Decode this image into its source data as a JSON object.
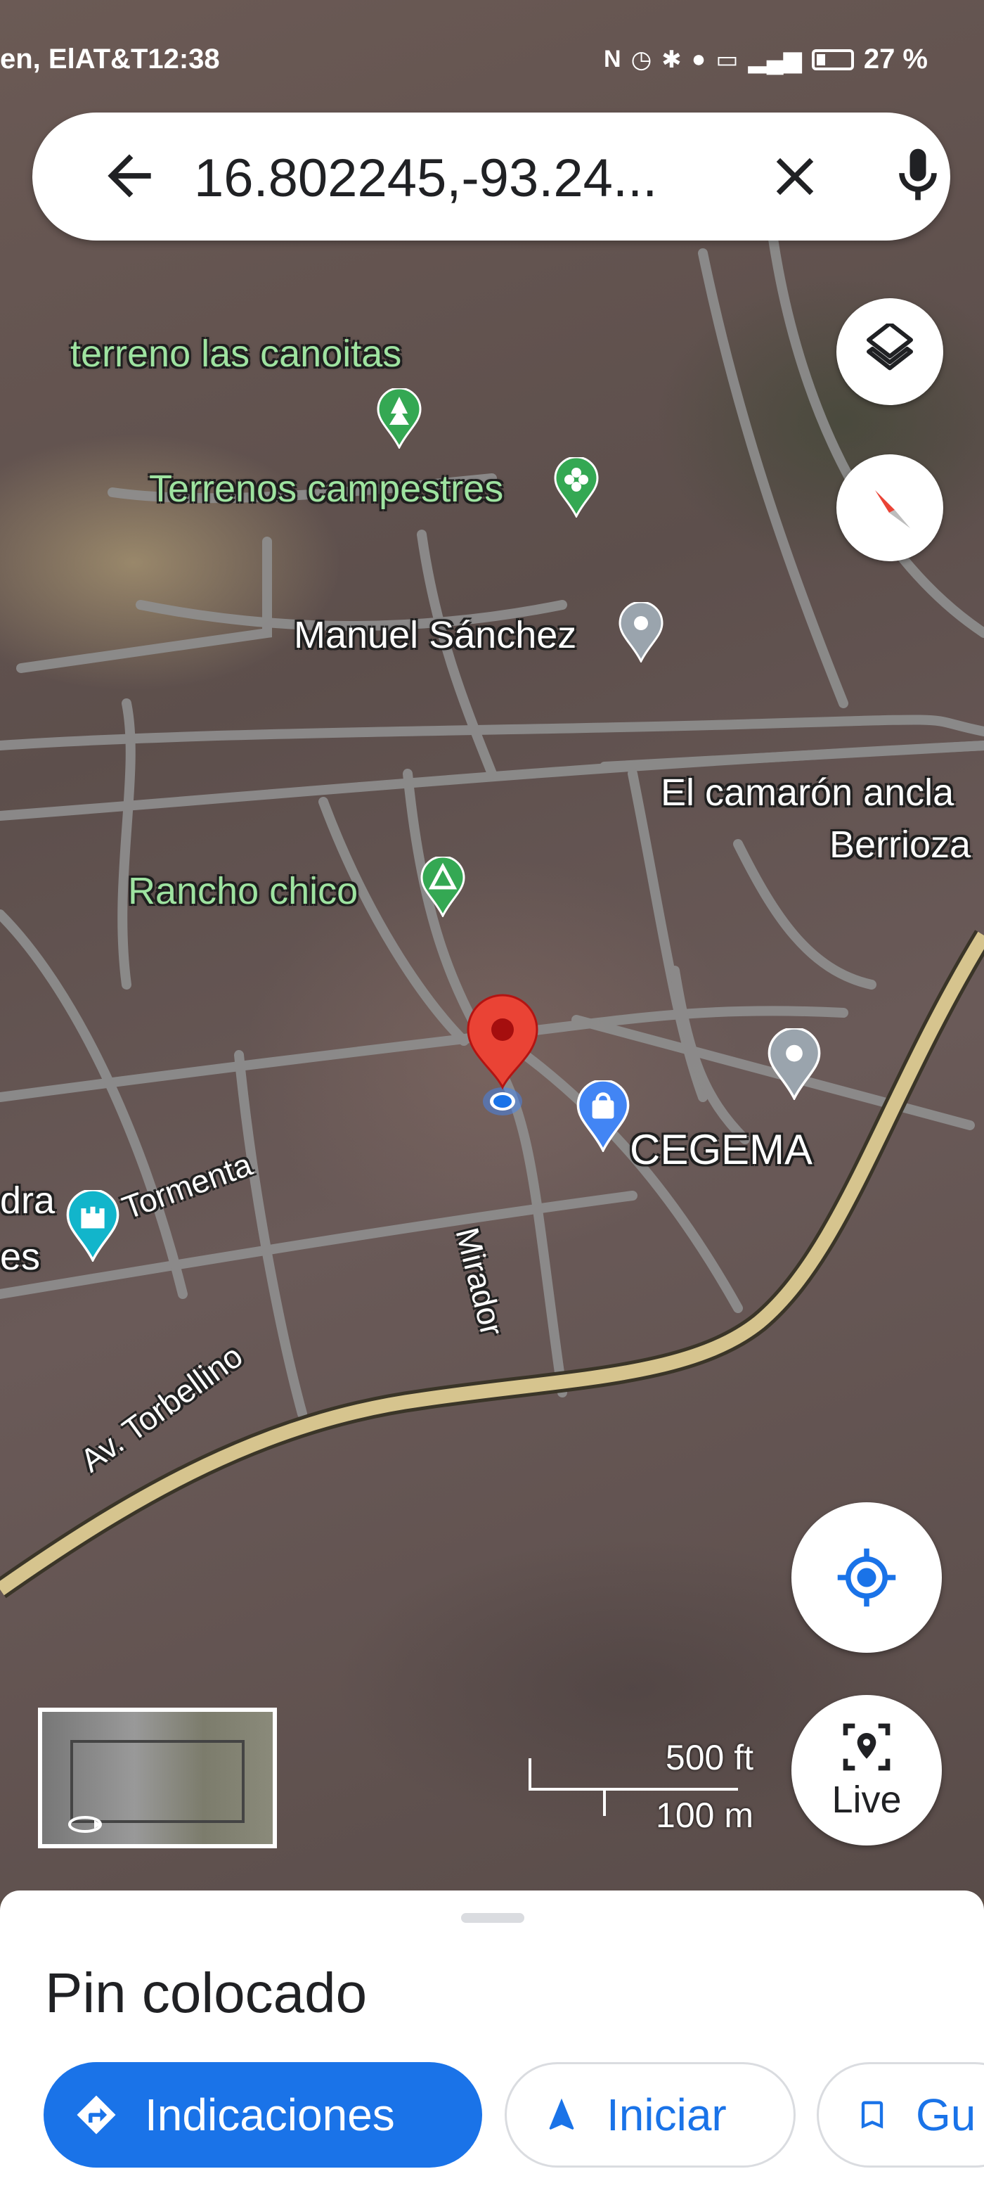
{
  "status_bar": {
    "carrier_time": "en, ElAT&T12:38",
    "battery": "27 %"
  },
  "search": {
    "query": "16.802245,-93.24...",
    "back_icon": "arrow-back-icon",
    "clear_icon": "close-icon",
    "mic_icon": "mic-icon"
  },
  "map": {
    "poi_labels": {
      "terreno": "terreno las canoitas",
      "terrenos": "Terrenos campestres",
      "manuel": "Manuel Sánchez",
      "camaron": "El camarón ancla",
      "berrioza": "Berrioza",
      "rancho": "Rancho chico",
      "cegema": "CEGEMA",
      "dra": "dra",
      "es": "es"
    },
    "street_labels": {
      "tormenta": "Tormenta",
      "mirador": "Mirador",
      "torbellino": "Av. Torbellino"
    },
    "scale": {
      "feet": "500 ft",
      "meters": "100 m"
    }
  },
  "controls": {
    "live_label": "Live"
  },
  "sheet": {
    "title": "Pin colocado",
    "directions_label": "Indicaciones",
    "start_label": "Iniciar",
    "save_label": "Gu"
  },
  "colors": {
    "accent_blue": "#1a73e8",
    "pin_red": "#ea4335",
    "road_main": "#d6c48e",
    "poi_green": "#9ee3a0"
  }
}
